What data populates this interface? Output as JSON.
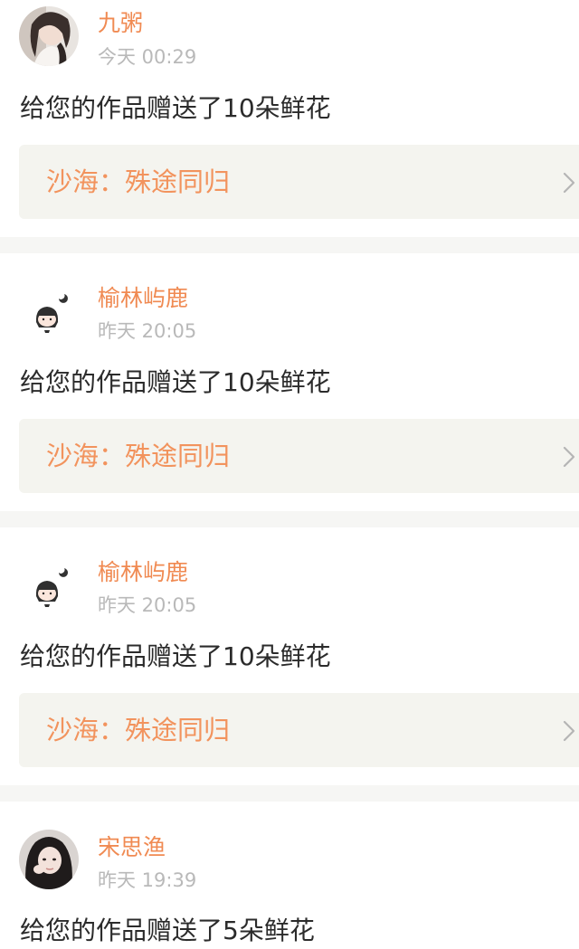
{
  "feed": {
    "items": [
      {
        "username": "九粥",
        "timestamp": "今天 00:29",
        "message": "给您的作品赠送了10朵鲜花",
        "work_title": "沙海：殊途同归",
        "avatar": "photo-avatar-girl"
      },
      {
        "username": "榆林屿鹿",
        "timestamp": "昨天 20:05",
        "message": "给您的作品赠送了10朵鲜花",
        "work_title": "沙海：殊途同归",
        "avatar": "cartoon-girl-avatar"
      },
      {
        "username": "榆林屿鹿",
        "timestamp": "昨天 20:05",
        "message": "给您的作品赠送了10朵鲜花",
        "work_title": "沙海：殊途同归",
        "avatar": "cartoon-girl-avatar"
      },
      {
        "username": "宋思渔",
        "timestamp": "昨天 19:39",
        "message": "给您的作品赠送了5朵鲜花",
        "avatar": "photo-avatar-girl-dark"
      }
    ]
  },
  "colors": {
    "username": "#f08a52",
    "work_title": "#f2935d",
    "timestamp": "#b9b9b9",
    "message": "#2b2b2b",
    "link_background": "#f4f4ef",
    "divider": "#f6f6f4"
  }
}
